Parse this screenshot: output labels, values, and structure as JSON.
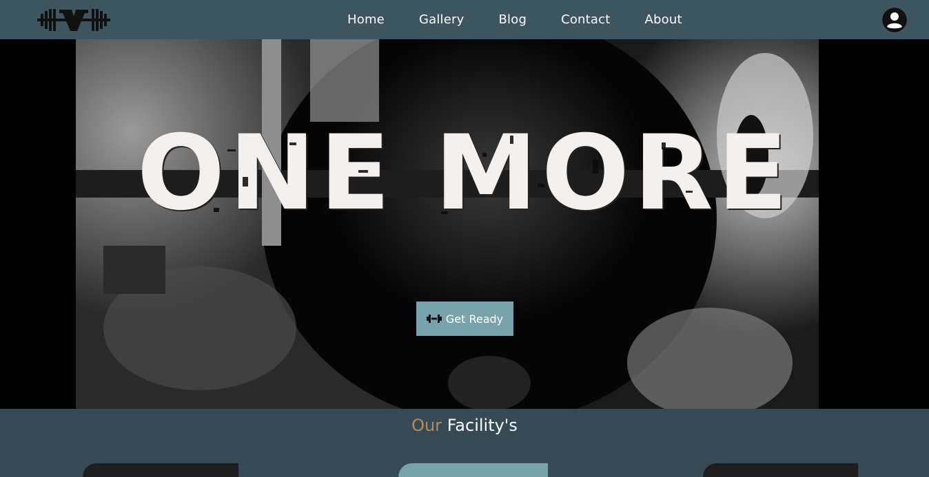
{
  "nav": {
    "links": [
      "Home",
      "Gallery",
      "Blog",
      "Contact",
      "About"
    ]
  },
  "hero": {
    "title": "ONE MORE",
    "cta_label": "Get Ready"
  },
  "facilities": {
    "title_accent": "Our",
    "title_rest": "Facility's"
  },
  "colors": {
    "navbar": "#3d555f",
    "section_bg": "#354a54",
    "cta": "#77a3ad",
    "accent": "#b98a5a"
  },
  "icons": {
    "logo": "dumbbell-v-logo",
    "avatar": "user-icon",
    "cta": "dumbbell-icon"
  }
}
